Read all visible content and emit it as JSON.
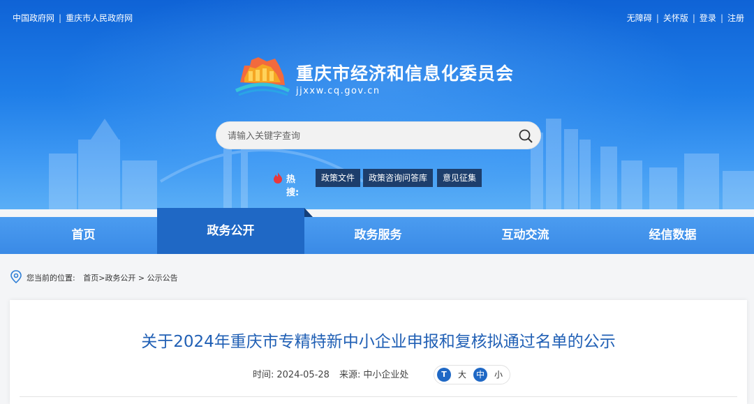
{
  "topbar": {
    "left_links": [
      "中国政府网",
      "重庆市人民政府网"
    ],
    "right_links": [
      "无障碍",
      "关怀版",
      "登录",
      "注册"
    ]
  },
  "site": {
    "title": "重庆市经济和信息化委员会",
    "domain": "jjxxw.cq.gov.cn"
  },
  "search": {
    "placeholder": "请输入关键字查询",
    "value": ""
  },
  "hot": {
    "label": "热搜:",
    "tags": [
      "政策文件",
      "政策咨询问答库",
      "意见征集"
    ]
  },
  "nav": {
    "items": [
      "首页",
      "政务公开",
      "政务服务",
      "互动交流",
      "经信数据"
    ],
    "active": "政务公开"
  },
  "breadcrumb": {
    "prefix": "您当前的位置:",
    "path": [
      "首页",
      "政务公开",
      "公示公告"
    ]
  },
  "article": {
    "title": "关于2024年重庆市专精特新中小企业申报和复核拟通过名单的公示",
    "time_label": "时间:",
    "time": "2024-05-28",
    "source_label": "来源:",
    "source": "中小企业处"
  },
  "font_control": {
    "icon_text": "T",
    "options": [
      "大",
      "中",
      "小"
    ],
    "selected": "中"
  },
  "colors": {
    "header": "#1f7ee8",
    "nav_active": "#1f68c5",
    "title": "#2160b5",
    "tag_bg": "#1d3e6c"
  }
}
